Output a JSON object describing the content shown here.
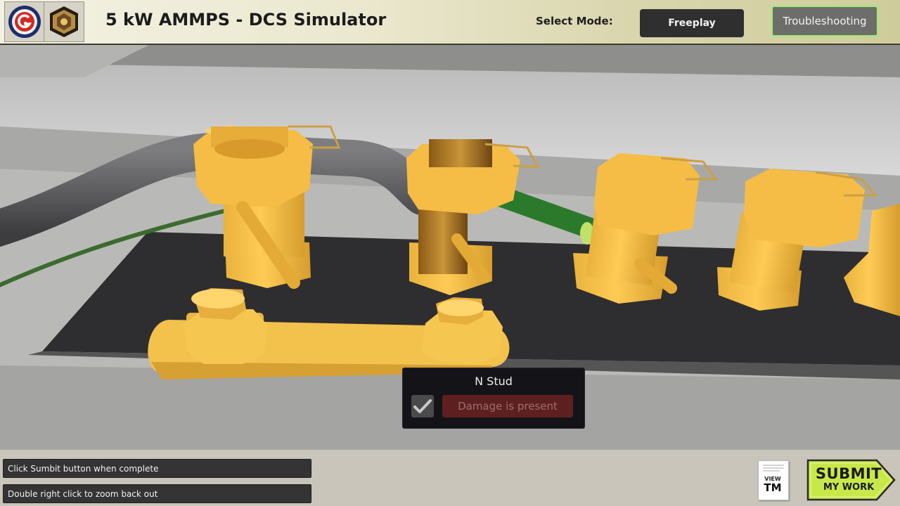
{
  "header": {
    "title": "5 kW AMMPS - DCS Simulator",
    "select_mode_label": "Select Mode:",
    "modes": [
      {
        "label": "Freeplay",
        "active": false
      },
      {
        "label": "Troubleshooting",
        "active": true
      }
    ],
    "logos": [
      "g-emblem-icon",
      "army-crest-icon"
    ]
  },
  "popup": {
    "title": "N Stud",
    "checked": true,
    "damage_label": "Damage is present"
  },
  "hints": [
    "Click Sumbit button when complete",
    "Double right click to zoom back out"
  ],
  "view_tm": {
    "small": "VIEW",
    "big": "TM"
  },
  "submit": {
    "line1": "SUBMIT",
    "line2": "MY WORK"
  },
  "colors": {
    "brass": "#f2c04a",
    "brass_dark": "#c8921f",
    "active_mode_border": "#9bef6e",
    "submit_green": "#c8e84a"
  }
}
